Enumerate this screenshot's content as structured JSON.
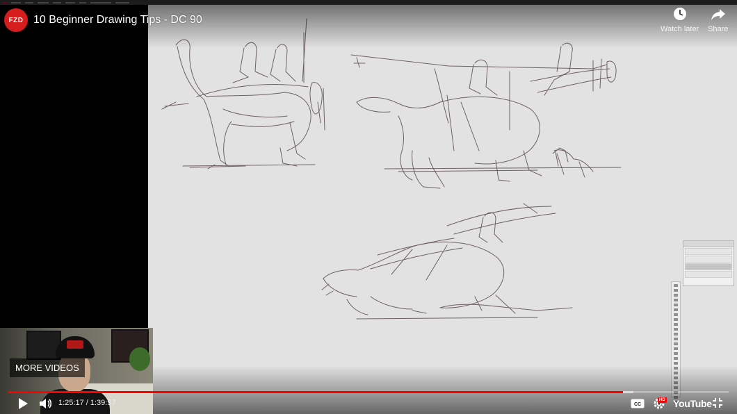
{
  "player": {
    "title": "10 Beginner Drawing Tips - DC 90",
    "channel_logo_text": "FZD",
    "watch_later_label": "Watch later",
    "share_label": "Share",
    "more_videos_label": "MORE VIDEOS",
    "time_current": "1:25:17",
    "time_separator": " / ",
    "time_total": "1:39:57",
    "cc_label": "CC",
    "hd_badge": "HD",
    "youtube_label": "YouTube",
    "progress_played_fraction": 0.853,
    "progress_buffered_fraction": 0.868,
    "accent_color": "#ff0000"
  },
  "icons": {
    "watch_later": "clock-icon",
    "share": "share-arrow-icon",
    "play": "play-icon",
    "volume": "volume-icon",
    "cc": "captions-icon",
    "settings": "gear-icon",
    "exit_fullscreen": "exit-fullscreen-icon"
  },
  "photoshop": {
    "layers": [
      "",
      "",
      "",
      ""
    ]
  }
}
